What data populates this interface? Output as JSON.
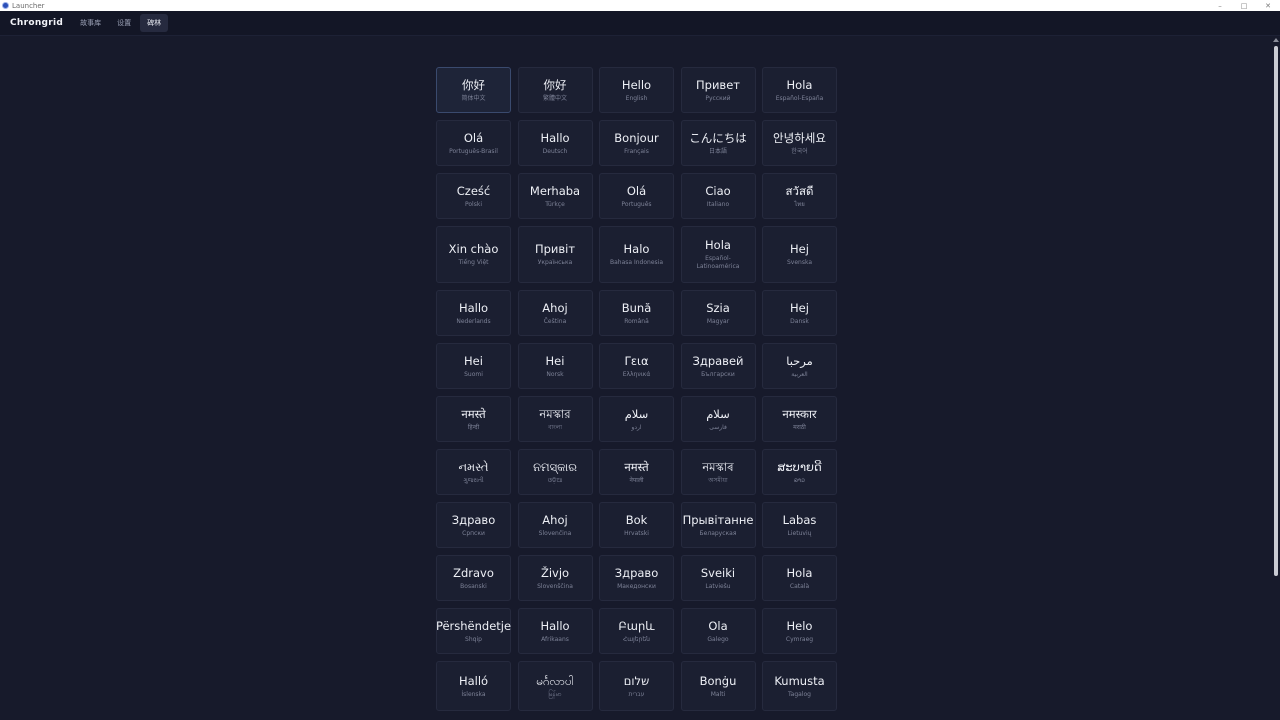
{
  "window": {
    "title": "Launcher"
  },
  "nav": {
    "brand": "Chrongrid",
    "items": [
      {
        "label": "故事库",
        "active": false
      },
      {
        "label": "设置",
        "active": false
      },
      {
        "label": "碑林",
        "active": true
      }
    ]
  },
  "cells": [
    {
      "greet": "你好",
      "lang": "简体中文",
      "selected": true
    },
    {
      "greet": "你好",
      "lang": "繁體中文"
    },
    {
      "greet": "Hello",
      "lang": "English"
    },
    {
      "greet": "Привет",
      "lang": "Русский"
    },
    {
      "greet": "Hola",
      "lang": "Español-España"
    },
    {
      "greet": "Olá",
      "lang": "Português-Brasil"
    },
    {
      "greet": "Hallo",
      "lang": "Deutsch"
    },
    {
      "greet": "Bonjour",
      "lang": "Français"
    },
    {
      "greet": "こんにちは",
      "lang": "日本語"
    },
    {
      "greet": "안녕하세요",
      "lang": "한국어"
    },
    {
      "greet": "Cześć",
      "lang": "Polski"
    },
    {
      "greet": "Merhaba",
      "lang": "Türkçe"
    },
    {
      "greet": "Olá",
      "lang": "Português"
    },
    {
      "greet": "Ciao",
      "lang": "Italiano"
    },
    {
      "greet": "สวัสดี",
      "lang": "ไทย"
    },
    {
      "greet": "Xin chào",
      "lang": "Tiếng Việt"
    },
    {
      "greet": "Привіт",
      "lang": "Українська"
    },
    {
      "greet": "Halo",
      "lang": "Bahasa Indonesia"
    },
    {
      "greet": "Hola",
      "lang": "Español-\nLatinoamérica"
    },
    {
      "greet": "Hej",
      "lang": "Svenska"
    },
    {
      "greet": "Hallo",
      "lang": "Nederlands"
    },
    {
      "greet": "Ahoj",
      "lang": "Čeština"
    },
    {
      "greet": "Bună",
      "lang": "Română"
    },
    {
      "greet": "Szia",
      "lang": "Magyar"
    },
    {
      "greet": "Hej",
      "lang": "Dansk"
    },
    {
      "greet": "Hei",
      "lang": "Suomi"
    },
    {
      "greet": "Hei",
      "lang": "Norsk"
    },
    {
      "greet": "Γεια",
      "lang": "Ελληνικά"
    },
    {
      "greet": "Здравей",
      "lang": "Български"
    },
    {
      "greet": "مرحبا",
      "lang": "العربية"
    },
    {
      "greet": "नमस्ते",
      "lang": "हिन्दी"
    },
    {
      "greet": "নমস্কার",
      "lang": "বাংলা"
    },
    {
      "greet": "سلام",
      "lang": "اردو"
    },
    {
      "greet": "سلام",
      "lang": "فارسی"
    },
    {
      "greet": "नमस्कार",
      "lang": "मराठी"
    },
    {
      "greet": "નમસ્તે",
      "lang": "ગુજરાતી"
    },
    {
      "greet": "ନମସ୍କାର",
      "lang": "ଓଡ଼ିଆ"
    },
    {
      "greet": "नमस्ते",
      "lang": "नेपाली"
    },
    {
      "greet": "নমস্কাৰ",
      "lang": "অসমীয়া"
    },
    {
      "greet": "ສະບາຍດີ",
      "lang": "ລາວ"
    },
    {
      "greet": "Здраво",
      "lang": "Српски"
    },
    {
      "greet": "Ahoj",
      "lang": "Slovenčina"
    },
    {
      "greet": "Bok",
      "lang": "Hrvatski"
    },
    {
      "greet": "Прывітанне",
      "lang": "Беларуская"
    },
    {
      "greet": "Labas",
      "lang": "Lietuvių"
    },
    {
      "greet": "Zdravo",
      "lang": "Bosanski"
    },
    {
      "greet": "Živjo",
      "lang": "Slovenščina"
    },
    {
      "greet": "Здраво",
      "lang": "Македонски"
    },
    {
      "greet": "Sveiki",
      "lang": "Latviešu"
    },
    {
      "greet": "Hola",
      "lang": "Català"
    },
    {
      "greet": "Përshëndetje",
      "lang": "Shqip"
    },
    {
      "greet": "Hallo",
      "lang": "Afrikaans"
    },
    {
      "greet": "Բարև",
      "lang": "Հայերեն"
    },
    {
      "greet": "Ola",
      "lang": "Galego"
    },
    {
      "greet": "Helo",
      "lang": "Cymraeg"
    },
    {
      "greet": "Halló",
      "lang": "Íslenska"
    },
    {
      "greet": "မင်္ဂလာပါ",
      "lang": "မြန်မာ"
    },
    {
      "greet": "שלום",
      "lang": "עברית"
    },
    {
      "greet": "Bonġu",
      "lang": "Malti"
    },
    {
      "greet": "Kumusta",
      "lang": "Tagalog"
    }
  ]
}
